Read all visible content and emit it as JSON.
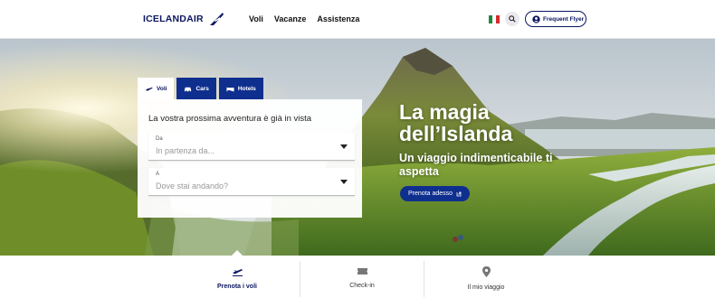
{
  "brand": {
    "name": "ICELANDAIR",
    "color": "#0b1560",
    "accent": "#0f2f8f"
  },
  "nav": {
    "items": [
      "Voli",
      "Vacanze",
      "Assistenza"
    ]
  },
  "header": {
    "flag": "italian-flag-icon",
    "frequent_flyer": "Frequent Flyer"
  },
  "booking": {
    "tabs": [
      {
        "label": "Voli",
        "icon": "plane-icon",
        "active": true
      },
      {
        "label": "Cars",
        "icon": "car-icon",
        "active": false
      },
      {
        "label": "Hotels",
        "icon": "bed-icon",
        "active": false
      }
    ],
    "title": "La vostra prossima avventura è già in vista",
    "from": {
      "label": "Da",
      "placeholder": "In partenza da..."
    },
    "to": {
      "label": "A",
      "placeholder": "Dove stai andando?"
    }
  },
  "hero": {
    "headline": "La magia dell’Islanda",
    "subheadline": "Un viaggio indimenticabile ti aspetta",
    "cta": "Prenota adesso"
  },
  "bottom_nav": [
    {
      "label": "Prenota i voli",
      "icon": "plane-departure-icon",
      "active": true
    },
    {
      "label": "Check-in",
      "icon": "ticket-icon",
      "active": false
    },
    {
      "label": "Il mio viaggio",
      "icon": "location-pin-icon",
      "active": false
    }
  ]
}
